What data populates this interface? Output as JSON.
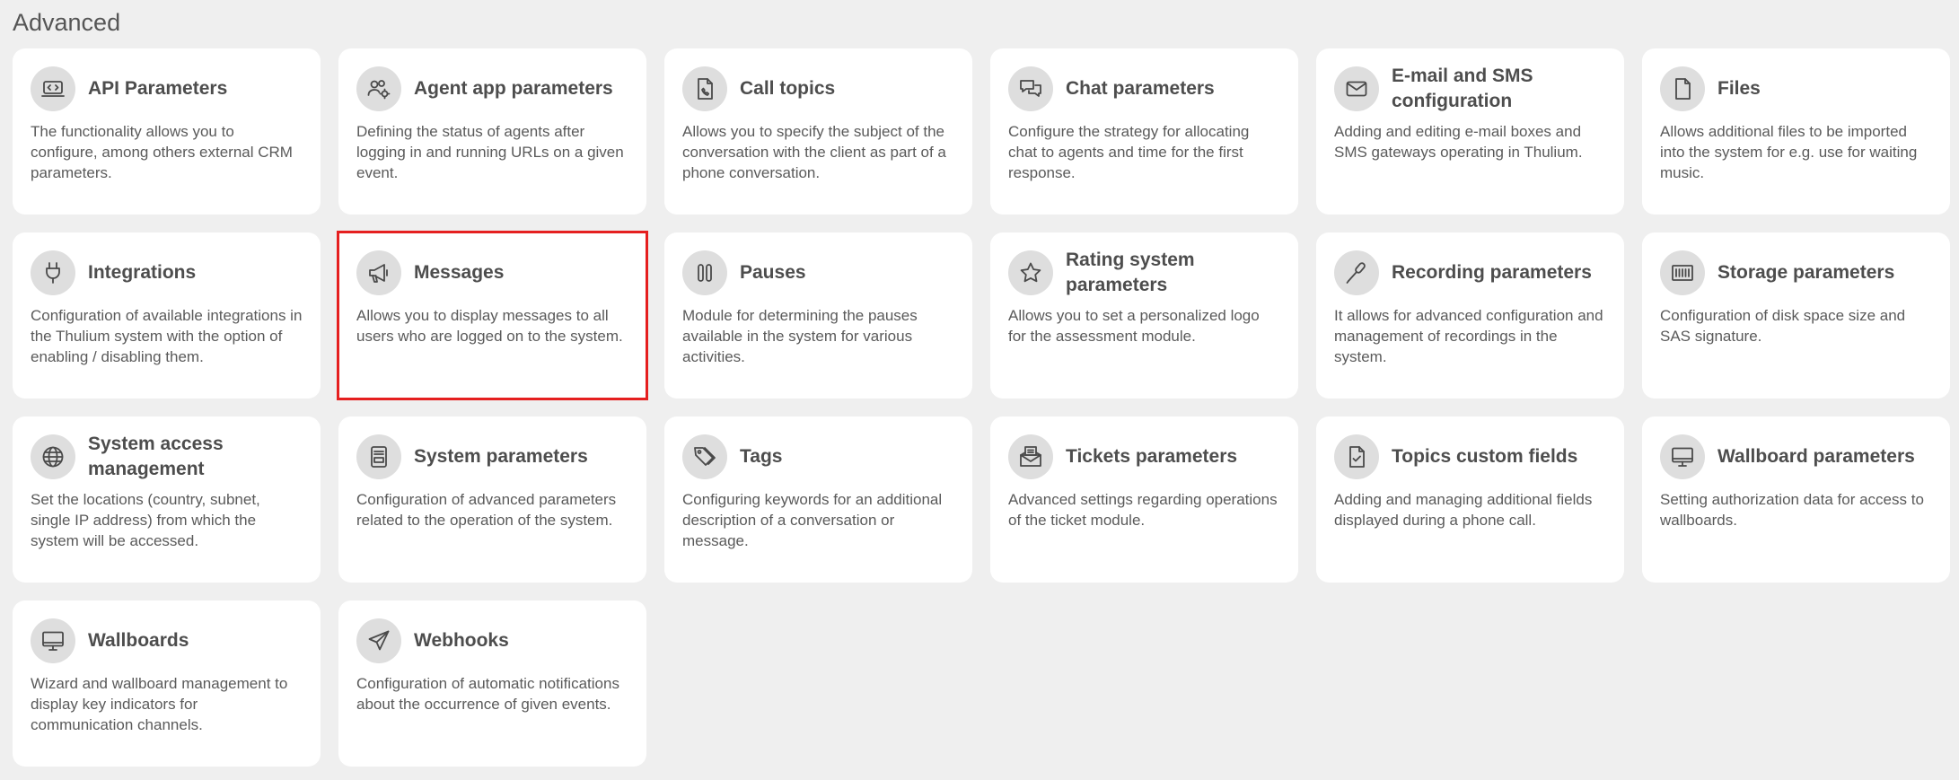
{
  "section": {
    "title": "Advanced"
  },
  "cards": [
    {
      "icon": "api-icon",
      "title": "API Parameters",
      "desc": "The functionality allows you to configure, among others external CRM parameters."
    },
    {
      "icon": "users-gear-icon",
      "title": "Agent app parameters",
      "desc": "Defining the status of agents after logging in and running URLs on a given event."
    },
    {
      "icon": "phone-file-icon",
      "title": "Call topics",
      "desc": "Allows you to specify the subject of the conversation with the client as part of a phone conversation."
    },
    {
      "icon": "chat-bubbles-icon",
      "title": "Chat parameters",
      "desc": "Configure the strategy for allocating chat to agents and time for the first response."
    },
    {
      "icon": "envelope-icon",
      "title": "E-mail and SMS configuration",
      "desc": "Adding and editing e-mail boxes and SMS gateways operating in Thulium."
    },
    {
      "icon": "file-icon",
      "title": "Files",
      "desc": "Allows additional files to be imported into the system for e.g. use for waiting music."
    },
    {
      "icon": "plug-icon",
      "title": "Integrations",
      "desc": "Configuration of available integrations in the Thulium system with the option of enabling / disabling them."
    },
    {
      "icon": "megaphone-icon",
      "title": "Messages",
      "desc": "Allows you to display messages to all users who are logged on to the system."
    },
    {
      "icon": "pause-icon",
      "title": "Pauses",
      "desc": "Module for determining the pauses available in the system for various activities."
    },
    {
      "icon": "star-icon",
      "title": "Rating system parameters",
      "desc": "Allows you to set a personalized logo for the assessment module."
    },
    {
      "icon": "microphone-icon",
      "title": "Recording parameters",
      "desc": "It allows for advanced configuration and management of recordings in the system."
    },
    {
      "icon": "storage-icon",
      "title": "Storage parameters",
      "desc": "Configuration of disk space size and SAS signature."
    },
    {
      "icon": "globe-icon",
      "title": "System access management",
      "desc": "Set the locations (country, subnet, single IP address) from which the system will be accessed."
    },
    {
      "icon": "server-icon",
      "title": "System parameters",
      "desc": "Configuration of advanced parameters related to the operation of the system."
    },
    {
      "icon": "tags-icon",
      "title": "Tags",
      "desc": "Configuring keywords for an additional description of a conversation or message."
    },
    {
      "icon": "ticket-inbox-icon",
      "title": "Tickets parameters",
      "desc": "Advanced settings regarding operations of the ticket module."
    },
    {
      "icon": "file-check-icon",
      "title": "Topics custom fields",
      "desc": "Adding and managing additional fields displayed during a phone call."
    },
    {
      "icon": "monitor-icon",
      "title": "Wallboard parameters",
      "desc": "Setting authorization data for access to wallboards."
    },
    {
      "icon": "monitor-icon",
      "title": "Wallboards",
      "desc": "Wizard and wallboard management to display key indicators for communication channels."
    },
    {
      "icon": "paper-plane-icon",
      "title": "Webhooks",
      "desc": "Configuration of automatic notifications about the occurrence of given events."
    }
  ]
}
